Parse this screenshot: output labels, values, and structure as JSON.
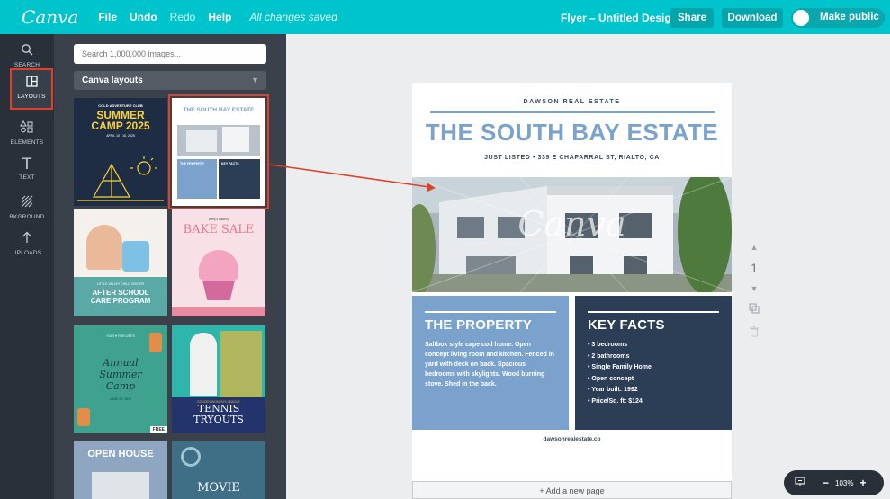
{
  "topbar": {
    "logo": "Canva",
    "menu": [
      "File",
      "Undo",
      "Redo",
      "Help"
    ],
    "saved_status": "All changes saved",
    "design_title": "Flyer – Untitled Design",
    "share_label": "Share",
    "download_label": "Download",
    "make_public_label": "Make public"
  },
  "rail": {
    "items": [
      {
        "label": "SEARCH",
        "icon": "search-icon"
      },
      {
        "label": "LAYOUTS",
        "icon": "layouts-icon",
        "active": true
      },
      {
        "label": "ELEMENTS",
        "icon": "elements-icon"
      },
      {
        "label": "TEXT",
        "icon": "text-icon"
      },
      {
        "label": "BKGROUND",
        "icon": "background-icon"
      },
      {
        "label": "UPLOADS",
        "icon": "upload-icon"
      }
    ]
  },
  "panel": {
    "search_placeholder": "Search 1,000,000 images...",
    "dropdown_value": "Canva layouts",
    "thumbnails": {
      "summer": {
        "top": "COLD ADVENTURE CLUB",
        "title1": "SUMMER",
        "title2": "CAMP 2025",
        "date": "APRIL 10 - 15, 2025"
      },
      "southbay": {
        "title": "THE SOUTH BAY ESTATE",
        "left": "THE PROPERTY",
        "right": "KEY FACTS"
      },
      "afterschool": {
        "small": "LITTLE VALLEY CHILD CENTER",
        "title1": "AFTER SCHOOL",
        "title2": "CARE PROGRAM"
      },
      "bakesale": {
        "top": "Betty's Bakery",
        "title": "BAKE SALE"
      },
      "annual": {
        "top": "YOUTH FOR LIFE'S",
        "title1": "Annual",
        "title2": "Summer",
        "title3": "Camp",
        "date": "JUNE 20, 2019",
        "badge": "FREE"
      },
      "tennis": {
        "small": "GOLDEN WOMEN'S LEAGUE",
        "title1": "TENNIS",
        "title2": "TRYOUTS"
      },
      "openhouse": {
        "title": "OPEN HOUSE"
      },
      "movie": {
        "title": "MOVIE"
      }
    }
  },
  "flyer": {
    "brand": "DAWSON REAL ESTATE",
    "title": "THE SOUTH BAY ESTATE",
    "subtitle": "JUST LISTED • 339 E CHAPARRAL ST, RIALTO, CA",
    "watermark": "Canva",
    "property_heading": "THE PROPERTY",
    "property_text": "Saltbox style cape cod home. Open concept living room and kitchen. Fenced in yard with deck on back. Spacious bedrooms with skylights. Wood burning stove. Shed in the back.",
    "facts_heading": "KEY FACTS",
    "facts": [
      "3 bedrooms",
      "2 bathrooms",
      "Single Family Home",
      "Open concept",
      "Year built: 1992",
      "Price/Sq. ft: $124"
    ],
    "url": "dawsonrealestate.co"
  },
  "canvas": {
    "page_number": "1",
    "add_page_label": "+ Add a new page",
    "zoom_level": "103%",
    "zoom_minus": "−",
    "zoom_plus": "+"
  },
  "colors": {
    "brand": "#00c4cc",
    "accent": "#e0412a",
    "flyer_blue": "#7aa2cc",
    "flyer_navy": "#2b3e55"
  }
}
